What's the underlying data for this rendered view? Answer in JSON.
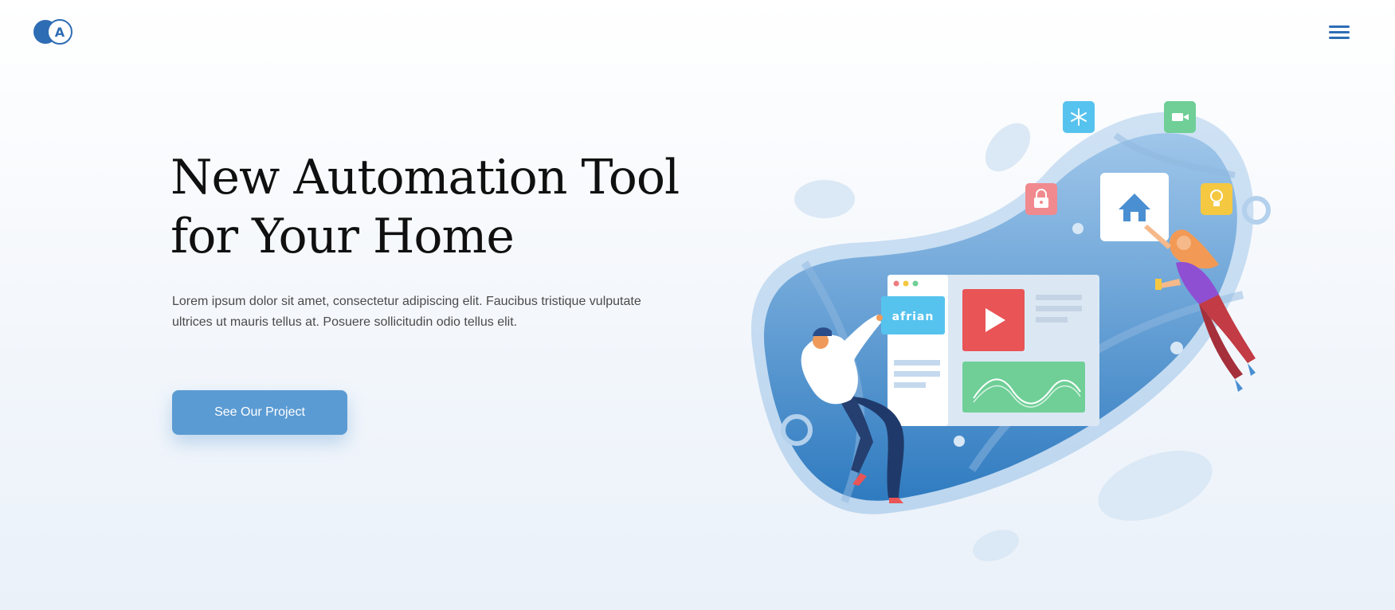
{
  "header": {
    "logo_letter": "A",
    "menu_icon": "hamburger-menu-icon"
  },
  "hero": {
    "title": "New Automation Tool for Your Home",
    "description": "Lorem ipsum dolor sit amet, consectetur adipiscing elit. Faucibus tristique vulputate ultrices ut mauris tellus at. Posuere sollicitudin odio tellus elit.",
    "cta_label": "See Our Project"
  },
  "illustration": {
    "badge_label": "afrian",
    "icons": [
      "snowflake-icon",
      "video-camera-icon",
      "lock-icon",
      "home-icon",
      "lightbulb-icon",
      "play-icon"
    ]
  },
  "colors": {
    "accent": "#5b9bd3",
    "brand_dark": "#2e6db4",
    "blob": "#3a84c6",
    "snowflake_tile": "#56c3ee",
    "camera_tile": "#6fcf97",
    "lock_tile": "#f08a8f",
    "bulb_tile": "#f5c842",
    "play_tile": "#e95456",
    "chart_tile": "#6fcf97"
  }
}
